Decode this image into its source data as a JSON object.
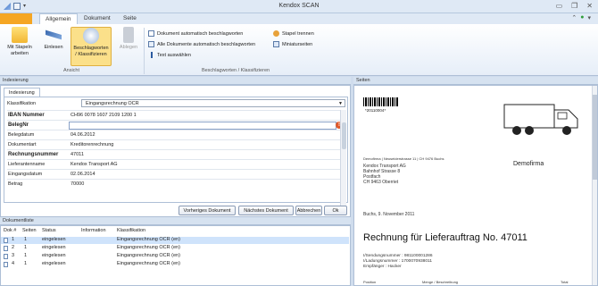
{
  "window": {
    "title": "Kendox SCAN"
  },
  "ribbon_tabs": {
    "file": "",
    "tabs": [
      "Allgemein",
      "Dokument",
      "Seite"
    ]
  },
  "ribbon": {
    "buttons": [
      {
        "label1": "Mit Stapeln",
        "label2": "arbeiten",
        "icon": "folder-stack-icon"
      },
      {
        "label1": "Einlesen",
        "label2": "",
        "icon": "scan-icon"
      },
      {
        "label1": "Beschlagworten",
        "label2": "/ Klassifizieren",
        "icon": "classify-icon"
      },
      {
        "label1": "Ablegen",
        "label2": "",
        "icon": "archive-icon"
      }
    ],
    "small_items": [
      "Dokument automatisch beschlagworten",
      "Alle Dokumente automatisch beschlagworten",
      "Text auswählen",
      "Stapel trennen",
      "Miniaturseiten"
    ],
    "groups": [
      "Ansicht",
      "Beschlagworten / Klassifizieren"
    ]
  },
  "indexing": {
    "panel_title": "Indexierung",
    "tab": "Indexierung",
    "klass_label": "Klassifikation",
    "klass_value": "Eingangsrechnung OCR",
    "fields": [
      {
        "label": "IBAN Nummer",
        "value": "CH96 0078 1607 2109 1200 1"
      },
      {
        "label": "BelegNr",
        "value": ""
      },
      {
        "label": "Belegdatum",
        "value": "04.06.2012"
      },
      {
        "label": "Dokumentart",
        "value": "Kreditorenrechnung"
      },
      {
        "label": "Rechnungsnummer",
        "value": "47011"
      },
      {
        "label": "Lieferantenname",
        "value": "Kendox Transport AG"
      },
      {
        "label": "Eingangsdatum",
        "value": "02.06.2014"
      },
      {
        "label": "Betrag",
        "value": "70000"
      }
    ],
    "buttons": [
      "Vorheriges Dokument",
      "Nächstes Dokument",
      "Abbrechen",
      "Ok"
    ]
  },
  "doclist": {
    "panel_title": "Dokumentliste",
    "headers": [
      "Dok #",
      "Seiten",
      "Status",
      "Information",
      "Klassifikation"
    ],
    "rows": [
      {
        "dok": "1",
        "seiten": "1",
        "status": "eingelesen",
        "info": "",
        "klass": "Eingangsrechnung OCR (en)"
      },
      {
        "dok": "2",
        "seiten": "1",
        "status": "eingelesen",
        "info": "",
        "klass": "Eingangsrechnung OCR (en)"
      },
      {
        "dok": "3",
        "seiten": "1",
        "status": "eingelesen",
        "info": "",
        "klass": "Eingangsrechnung OCR (en)"
      },
      {
        "dok": "4",
        "seiten": "1",
        "status": "eingelesen",
        "info": "",
        "klass": "Eingangsrechnung OCR (en)"
      }
    ]
  },
  "preview": {
    "panel_title": "Seiten",
    "barcode_text": "*20110004*",
    "sender_line": "Demofirma | Neuseiderstrasse 11 | CH 9476 Buchs",
    "address": [
      "Kendox Transport AG",
      "Bahnhof Strasse 8",
      "Postfach",
      "CH 9463 Oberriet"
    ],
    "company": "Demofirma",
    "date_line": "Buchs, 9. November 2011",
    "title": "Rechnung für Lieferauftrag No. 47011",
    "ref_lines": [
      "I/Sendungsnummer : 981100001286",
      "I/Ladungsnummer : 1700070938011",
      "Empfänger : Hacker"
    ],
    "footer_cols": [
      "Position",
      "Menge / Beschreibung",
      "Total"
    ]
  }
}
